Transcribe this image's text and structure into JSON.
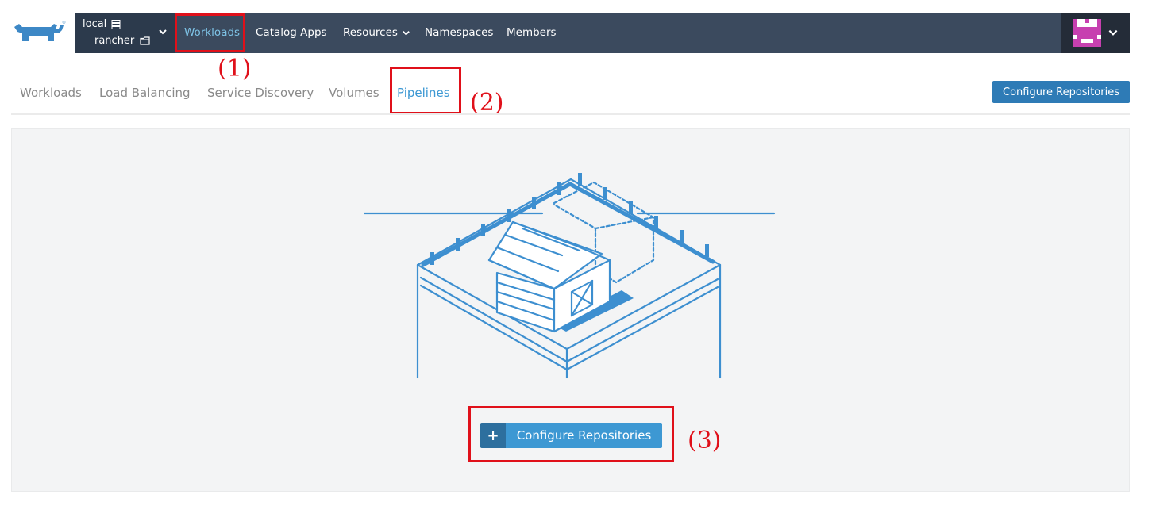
{
  "header": {
    "cluster_name": "local",
    "project_name": "rancher",
    "nav": [
      {
        "label": "Workloads"
      },
      {
        "label": "Catalog Apps"
      },
      {
        "label": "Resources"
      },
      {
        "label": "Namespaces"
      },
      {
        "label": "Members"
      }
    ]
  },
  "subtabs": [
    {
      "label": "Workloads"
    },
    {
      "label": "Load Balancing"
    },
    {
      "label": "Service Discovery"
    },
    {
      "label": "Volumes"
    },
    {
      "label": "Pipelines"
    }
  ],
  "actions": {
    "configure_top_label": "Configure Repositories",
    "configure_main_label": "Configure Repositories",
    "plus_symbol": "+"
  },
  "annotations": [
    "(1)",
    "(2)",
    "(3)"
  ],
  "icons": [
    "rancher-logo",
    "cluster-icon",
    "project-icon",
    "chevron-down-icon",
    "user-avatar",
    "pipeline-farm-illustration",
    "plus-icon"
  ],
  "colors": {
    "topbar": "#3b4a5e",
    "active_nav": "#7ec3e6",
    "accent": "#3d98d3",
    "button_dark": "#2e7bb6",
    "annotation_red": "#e0101a",
    "avatar_magenta": "#c740b0"
  }
}
